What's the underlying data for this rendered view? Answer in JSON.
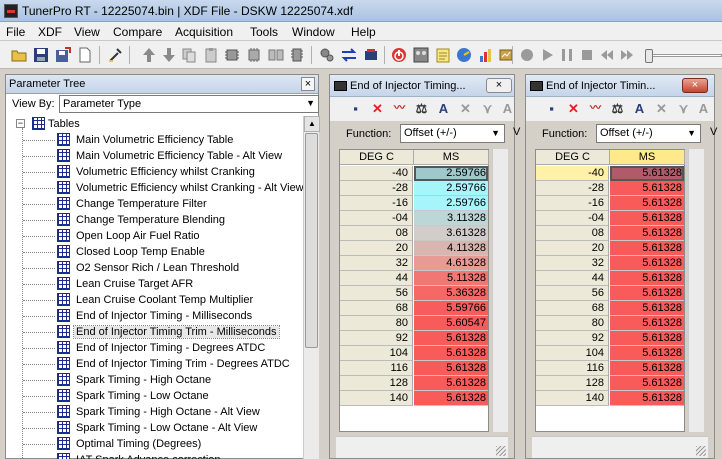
{
  "app": {
    "title": "TunerPro RT - 12225074.bin | XDF File - DSKW  12225074.xdf"
  },
  "menu": [
    "File",
    "XDF",
    "View",
    "Compare",
    "Acquisition",
    "Tools",
    "Window",
    "Help"
  ],
  "param_tree": {
    "title": "Parameter Tree",
    "close": "×",
    "view_by_label": "View By:",
    "view_by_value": "Parameter Type",
    "root": "Tables",
    "items": [
      "Main Volumetric Efficiency Table",
      "Main Volumetric Efficiency Table - Alt View",
      "Volumetric Efficiency whilst Cranking",
      "Volumetric Efficiency whilst Cranking - Alt View",
      "Change Temperature Filter",
      "Change Temperature Blending",
      "Open Loop Air Fuel Ratio",
      "Closed Loop Temp Enable",
      "O2 Sensor Rich /  Lean Threshold",
      "Lean Cruise Target AFR",
      "Lean Cruise Coolant Temp Multiplier",
      "End of Injector Timing - Milliseconds",
      "End of Injector Timing Trim - Milliseconds",
      "End of Injector Timing - Degrees ATDC",
      "End of Injector Timing Trim - Degrees ATDC",
      "Spark Timing - High Octane",
      "Spark Timing - Low Octane",
      "Spark Timing - High Octane - Alt View",
      "Spark Timing - Low Octane - Alt View",
      "Optimal Timing (Degrees)",
      "IAT Spark Advance correction"
    ],
    "selected_index": 12
  },
  "win_left": {
    "title": "End of Injector Timing...",
    "close": "×",
    "function_label": "Function:",
    "function_value": "Offset (+/-)",
    "col_x": "DEG C",
    "col_y": "MS",
    "rows": [
      {
        "x": "-40",
        "v": "2.59766",
        "c": "#9ec8cc"
      },
      {
        "x": "-28",
        "v": "2.59766",
        "c": "#a5f5fb"
      },
      {
        "x": "-16",
        "v": "2.59766",
        "c": "#a5f5fb"
      },
      {
        "x": "-04",
        "v": "3.11328",
        "c": "#bcd8d6"
      },
      {
        "x": "08",
        "v": "3.61328",
        "c": "#d0cdcb"
      },
      {
        "x": "20",
        "v": "4.11328",
        "c": "#d9b5b0"
      },
      {
        "x": "32",
        "v": "4.61328",
        "c": "#e89b95"
      },
      {
        "x": "44",
        "v": "5.11328",
        "c": "#f27674"
      },
      {
        "x": "56",
        "v": "5.36328",
        "c": "#f66865"
      },
      {
        "x": "68",
        "v": "5.59766",
        "c": "#f85c5c"
      },
      {
        "x": "80",
        "v": "5.60547",
        "c": "#f95b5b"
      },
      {
        "x": "92",
        "v": "5.61328",
        "c": "#f95a5a"
      },
      {
        "x": "104",
        "v": "5.61328",
        "c": "#f95a5a"
      },
      {
        "x": "116",
        "v": "5.61328",
        "c": "#f95a5a"
      },
      {
        "x": "128",
        "v": "5.61328",
        "c": "#f95a5a"
      },
      {
        "x": "140",
        "v": "5.61328",
        "c": "#f95a5a"
      }
    ]
  },
  "win_right": {
    "title": "End of Injector Timin...",
    "close": "×",
    "function_label": "Function:",
    "function_value": "Offset (+/-)",
    "col_x": "DEG C",
    "col_y": "MS",
    "rows": [
      {
        "x": "-40",
        "v": "5.61328",
        "c": "#b05a6a"
      },
      {
        "x": "-28",
        "v": "5.61328",
        "c": "#f95a5a"
      },
      {
        "x": "-16",
        "v": "5.61328",
        "c": "#f95a5a"
      },
      {
        "x": "-04",
        "v": "5.61328",
        "c": "#f95a5a"
      },
      {
        "x": "08",
        "v": "5.61328",
        "c": "#f95a5a"
      },
      {
        "x": "20",
        "v": "5.61328",
        "c": "#f95a5a"
      },
      {
        "x": "32",
        "v": "5.61328",
        "c": "#f95a5a"
      },
      {
        "x": "44",
        "v": "5.61328",
        "c": "#f95a5a"
      },
      {
        "x": "56",
        "v": "5.61328",
        "c": "#f95a5a"
      },
      {
        "x": "68",
        "v": "5.61328",
        "c": "#f95a5a"
      },
      {
        "x": "80",
        "v": "5.61328",
        "c": "#f95a5a"
      },
      {
        "x": "92",
        "v": "5.61328",
        "c": "#f95a5a"
      },
      {
        "x": "104",
        "v": "5.61328",
        "c": "#f95a5a"
      },
      {
        "x": "116",
        "v": "5.61328",
        "c": "#f95a5a"
      },
      {
        "x": "128",
        "v": "5.61328",
        "c": "#f95a5a"
      },
      {
        "x": "140",
        "v": "5.61328",
        "c": "#f95a5a"
      }
    ]
  },
  "partial_label": "V"
}
